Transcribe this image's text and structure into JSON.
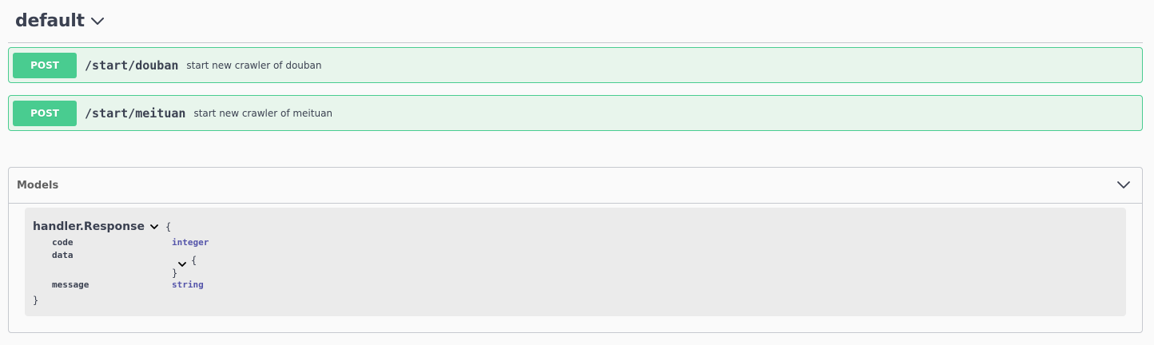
{
  "tag": {
    "title": "default",
    "chevron_icon": "chevron-down-icon"
  },
  "operations": [
    {
      "method": "POST",
      "path": "/start/douban",
      "description": "start new crawler of douban",
      "color": "#49cc90",
      "background": "#e8f5ec"
    },
    {
      "method": "POST",
      "path": "/start/meituan",
      "description": "start new crawler of meituan",
      "color": "#49cc90",
      "background": "#e8f5ec"
    }
  ],
  "models": {
    "title": "Models",
    "chevron_icon": "chevron-down-icon",
    "model": {
      "name": "handler.Response",
      "open_brace": "{",
      "close_brace": "}",
      "properties": [
        {
          "name": "code",
          "type": "integer"
        },
        {
          "name": "data",
          "type": "",
          "nested_open": "{",
          "nested_close": "}"
        },
        {
          "name": "message",
          "type": "string"
        }
      ]
    }
  },
  "colors": {
    "post_green": "#49cc90",
    "type_color": "#5555aa",
    "text": "#3b4151"
  }
}
